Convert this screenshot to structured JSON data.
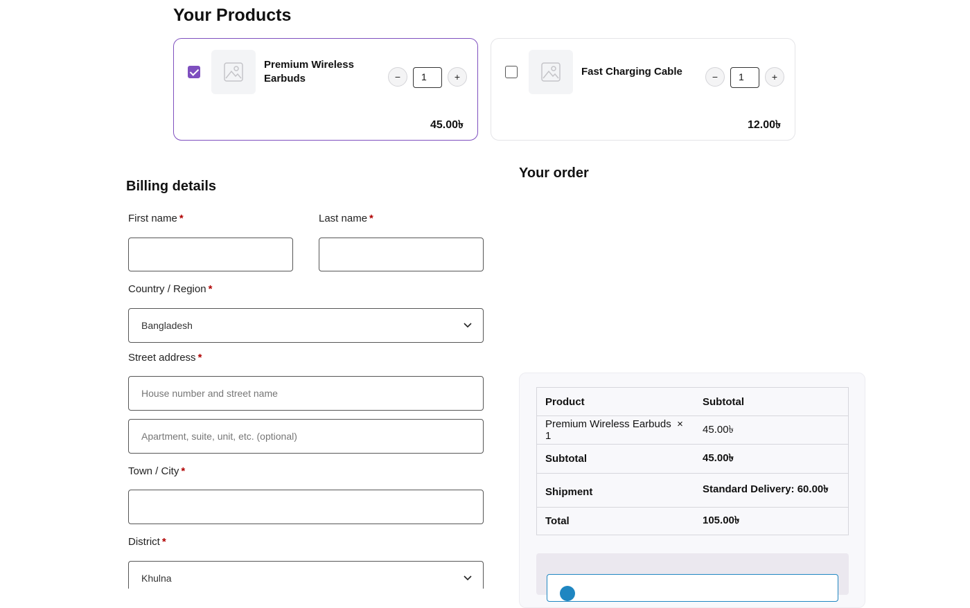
{
  "products_section": {
    "title": "Your Products"
  },
  "products": [
    {
      "name": "Premium Wireless Earbuds",
      "name_line1": "Premium Wireless",
      "name_line2": "Earbuds",
      "quantity": "1",
      "price": "45.00৳",
      "selected": true,
      "image_icon": "image-placeholder-icon"
    },
    {
      "name": "Fast Charging Cable",
      "quantity": "1",
      "price": "12.00৳",
      "selected": false,
      "image_icon": "image-placeholder-icon"
    }
  ],
  "qty_controls": {
    "minus": "−",
    "plus": "+"
  },
  "billing": {
    "title": "Billing details",
    "required_mark": "*",
    "first_name_label": "First name",
    "last_name_label": "Last name",
    "country_label": "Country / Region",
    "country_value": "Bangladesh",
    "street_label": "Street address",
    "street_placeholder": "House number and street name",
    "apartment_placeholder": "Apartment, suite, unit, etc. (optional)",
    "city_label": "Town / City",
    "district_label": "District",
    "district_value": "Khulna"
  },
  "order": {
    "title": "Your order",
    "header_product": "Product",
    "header_subtotal": "Subtotal",
    "line_item_name": "Premium Wireless Earbuds",
    "line_item_qty": "× 1",
    "line_item_total": "45.00৳",
    "subtotal_label": "Subtotal",
    "subtotal_value": "45.00৳",
    "shipment_label": "Shipment",
    "shipment_value": "Standard Delivery: 60.00৳",
    "total_label": "Total",
    "total_value": "105.00৳"
  },
  "colors": {
    "accent": "#7e4fbf",
    "required": "#b00000",
    "info": "#1f86c1"
  }
}
